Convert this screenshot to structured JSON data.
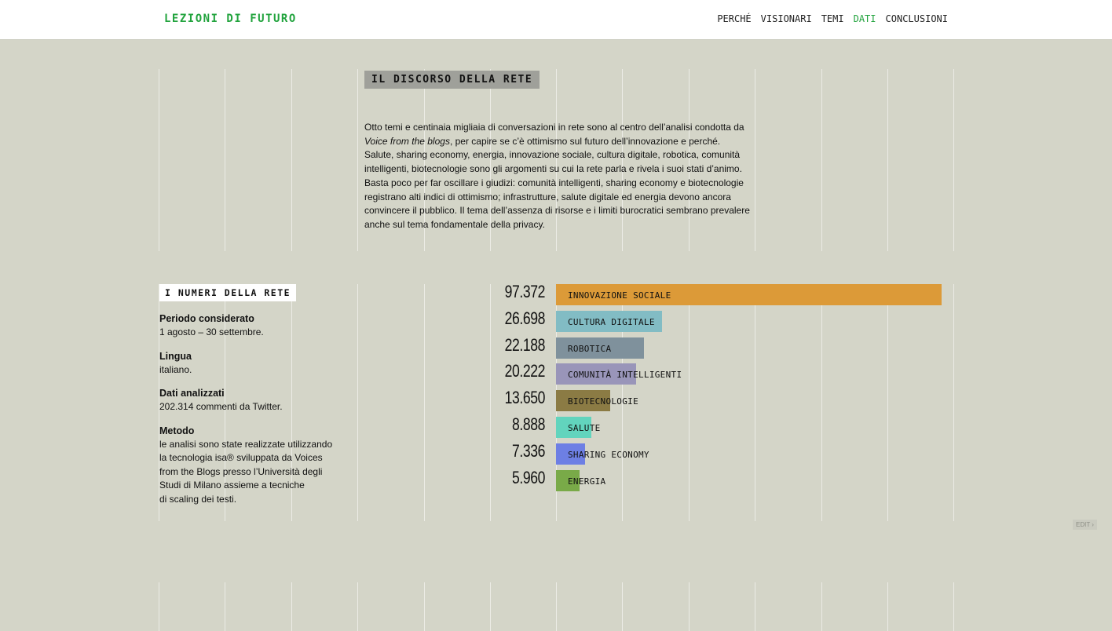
{
  "brand": {
    "title": "LEZIONI DI FUTURO"
  },
  "nav": {
    "items": [
      {
        "label": "PERCHÉ",
        "active": false
      },
      {
        "label": "VISIONARI",
        "active": false
      },
      {
        "label": "TEMI",
        "active": false
      },
      {
        "label": "DATI",
        "active": true
      },
      {
        "label": "CONCLUSIONI",
        "active": false
      }
    ],
    "active_color": "#21a33d"
  },
  "discorso": {
    "heading": "IL DISCORSO DELLA RETE",
    "text_before": "Otto temi e centinaia migliaia di conversazioni in rete sono al centro dell’analisi condotta da ",
    "text_emph": "Voice from the blogs",
    "text_after": ", per capire se c’è ottimismo sul futuro dell’innovazione e perché. Salute, sharing economy, energia, innovazione sociale, cultura digitale, robotica, comunità intelligenti, biotecnologie sono gli argomenti su cui la rete parla e rivela i suoi stati d’animo. Basta poco per far oscillare i giudizi: comunità intelligenti, sharing economy e biotecnologie registrano alti indici di ottimismo; infrastrutture, salute digitale ed energia devono ancora convincere il pubblico. Il tema dell’assenza di risorse e i limiti burocratici sembrano prevalere anche sul tema fondamentale della privacy."
  },
  "numeri": {
    "heading": "I NUMERI DELLA RETE",
    "facts": [
      {
        "label": "Periodo considerato",
        "value": "1 agosto – 30 settembre."
      },
      {
        "label": "Lingua",
        "value": "italiano."
      },
      {
        "label": "Dati analizzati",
        "value": "202.314 commenti da Twitter."
      },
      {
        "label": "Metodo",
        "value": "le analisi sono state realizzate utilizzando\nla tecnologia isa® sviluppata da Voices\nfrom the Blogs presso l’Università degli\nStudi di Milano assieme a tecniche\ndi scaling dei testi."
      }
    ]
  },
  "chart_data": {
    "type": "bar",
    "orientation": "horizontal",
    "categories": [
      "INNOVAZIONE SOCIALE",
      "CULTURA DIGITALE",
      "ROBOTICA",
      "COMUNITÀ INTELLIGENTI",
      "BIOTECNOLOGIE",
      "SALUTE",
      "SHARING ECONOMY",
      "ENERGIA"
    ],
    "values": [
      97372,
      26698,
      22188,
      20222,
      13650,
      8888,
      7336,
      5960
    ],
    "value_labels": [
      "97.372",
      "26.698",
      "22.188",
      "20.222",
      "13.650",
      "8.888",
      "7.336",
      "5.960"
    ],
    "colors": [
      "#dc9a38",
      "#82bcc4",
      "#7f919c",
      "#9995b9",
      "#8b7b44",
      "#62d4bd",
      "#6d7fe4",
      "#79aa48"
    ],
    "xlim": [
      0,
      97372
    ],
    "grid": false,
    "legend": "none"
  },
  "edit": {
    "label": "EDIT ›"
  }
}
